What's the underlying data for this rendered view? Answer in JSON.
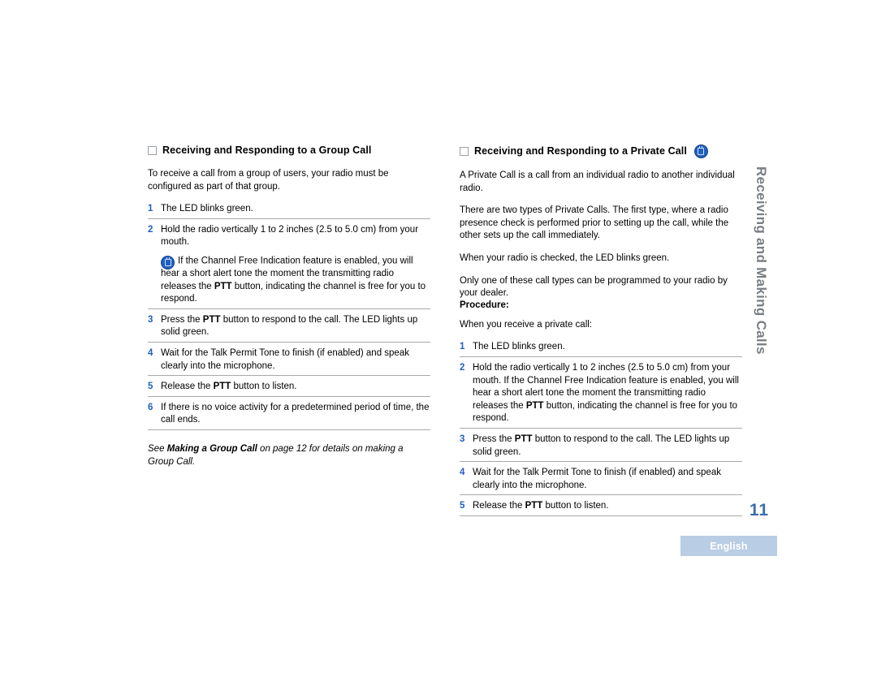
{
  "document": {
    "page_number": "11",
    "language_label": "English",
    "side_tab": "Receiving and Making Calls"
  },
  "left_column": {
    "heading": "Receiving and Responding to a Group Call",
    "has_icon": false,
    "intro": "To receive a call from a group of users, your radio must be configured as part of that group.",
    "steps": [
      {
        "num": "1",
        "parts": [
          {
            "t": "The LED blinks green.",
            "b": false
          }
        ],
        "note": null
      },
      {
        "num": "2",
        "parts": [
          {
            "t": "Hold the radio vertically 1 to 2 inches (2.5 to 5.0 cm) from your mouth.",
            "b": false
          }
        ],
        "note": {
          "parts": [
            {
              "t": "If the Channel Free Indication feature is enabled, you will hear a short alert tone the moment the transmitting radio releases the ",
              "b": false
            },
            {
              "t": "PTT",
              "b": true
            },
            {
              "t": " button, indicating the channel is free for you to respond.",
              "b": false
            }
          ]
        }
      },
      {
        "num": "3",
        "parts": [
          {
            "t": "Press the ",
            "b": false
          },
          {
            "t": "PTT",
            "b": true
          },
          {
            "t": " button to respond to the call. The LED lights up solid green.",
            "b": false
          }
        ],
        "note": null
      },
      {
        "num": "4",
        "parts": [
          {
            "t": "Wait for the Talk Permit Tone to finish (if enabled) and speak clearly into the microphone.",
            "b": false
          }
        ],
        "note": null
      },
      {
        "num": "5",
        "parts": [
          {
            "t": "Release the ",
            "b": false
          },
          {
            "t": "PTT",
            "b": true
          },
          {
            "t": " button to listen.",
            "b": false
          }
        ],
        "note": null
      },
      {
        "num": "6",
        "parts": [
          {
            "t": "If there is no voice activity for a predetermined period of time, the call ends.",
            "b": false
          }
        ],
        "note": null
      }
    ],
    "see_also": [
      {
        "t": "See ",
        "b": false
      },
      {
        "t": "Making a Group Call",
        "b": true
      },
      {
        "t": " on page 12 for details on making a Group Call.",
        "b": false
      }
    ]
  },
  "right_column": {
    "heading": "Receiving and Responding to a Private Call",
    "has_icon": true,
    "paragraphs": [
      "A Private Call is a call from an individual radio to another individual radio.",
      "There are two types of Private Calls. The first type, where a radio presence check is performed prior to setting up the call, while the other sets up the call immediately.",
      "When your radio is checked, the LED blinks green.",
      "Only one of these call types can be programmed to your radio by your dealer."
    ],
    "procedure_label": "Procedure:",
    "procedure_intro": "When you receive a private call:",
    "steps": [
      {
        "num": "1",
        "parts": [
          {
            "t": "The LED blinks green.",
            "b": false
          }
        ]
      },
      {
        "num": "2",
        "parts": [
          {
            "t": "Hold the radio vertically 1 to 2 inches (2.5 to 5.0 cm) from your mouth. If the Channel Free Indication feature is enabled, you will hear a short alert tone the moment the transmitting radio releases the ",
            "b": false
          },
          {
            "t": "PTT",
            "b": true
          },
          {
            "t": " button, indicating the channel is free for you to respond.",
            "b": false
          }
        ]
      },
      {
        "num": "3",
        "parts": [
          {
            "t": "Press the ",
            "b": false
          },
          {
            "t": "PTT",
            "b": true
          },
          {
            "t": " button to respond to the call. The LED lights up solid green.",
            "b": false
          }
        ]
      },
      {
        "num": "4",
        "parts": [
          {
            "t": "Wait for the Talk Permit Tone to finish (if enabled) and speak clearly into the microphone.",
            "b": false
          }
        ]
      },
      {
        "num": "5",
        "parts": [
          {
            "t": "Release the ",
            "b": false
          },
          {
            "t": "PTT",
            "b": true
          },
          {
            "t": " button to listen.",
            "b": false
          }
        ]
      }
    ]
  }
}
